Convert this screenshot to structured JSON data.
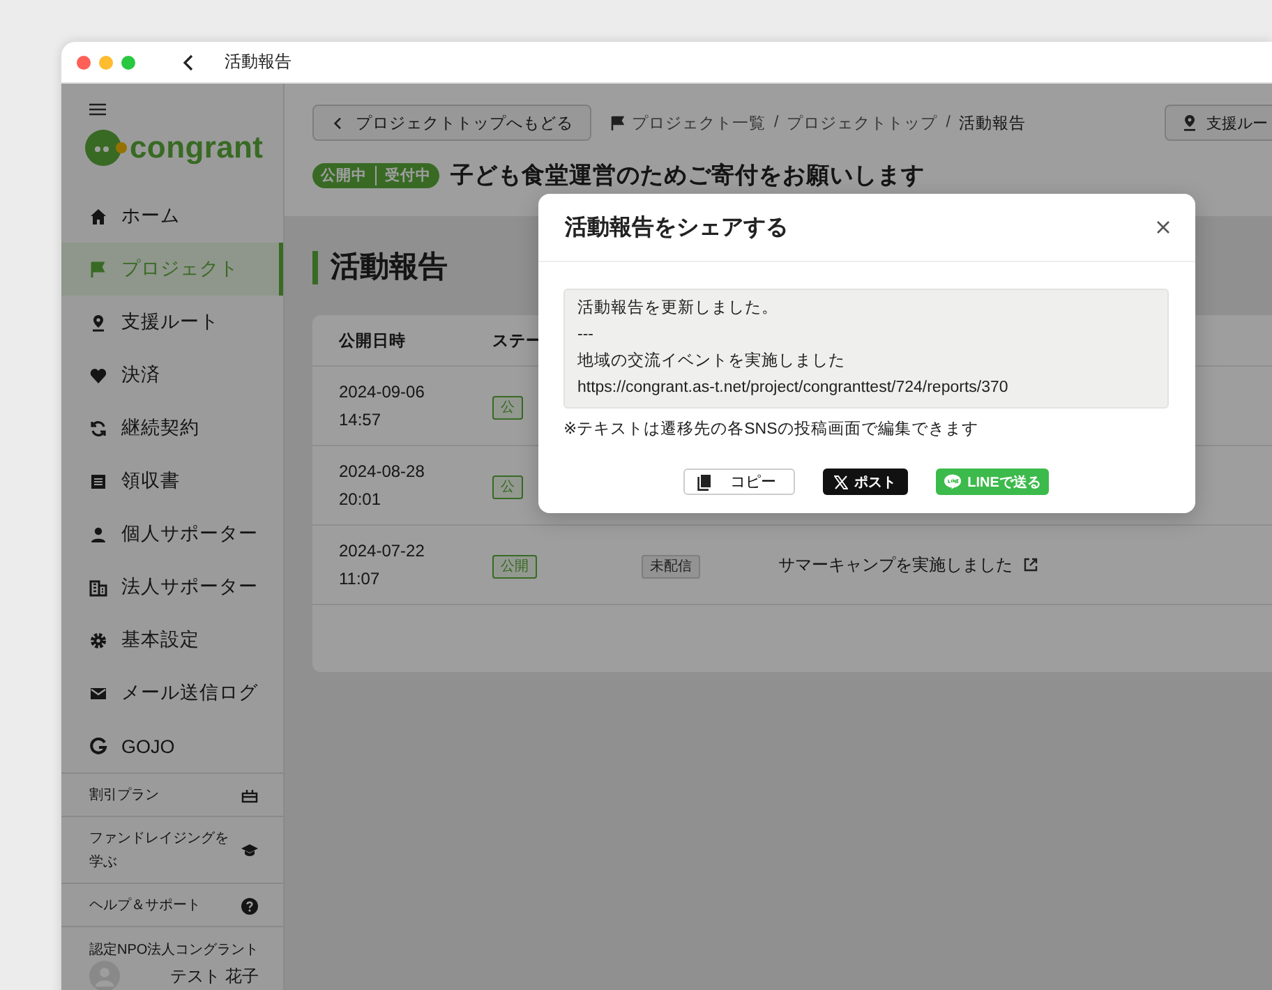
{
  "window": {
    "title": "活動報告"
  },
  "sidebar": {
    "logo_text": "congrant",
    "items": [
      {
        "label": "ホーム",
        "selected": false
      },
      {
        "label": "プロジェクト",
        "selected": true
      },
      {
        "label": "支援ルート",
        "selected": false
      },
      {
        "label": "決済",
        "selected": false
      },
      {
        "label": "継続契約",
        "selected": false
      },
      {
        "label": "領収書",
        "selected": false
      },
      {
        "label": "個人サポーター",
        "selected": false
      },
      {
        "label": "法人サポーター",
        "selected": false
      },
      {
        "label": "基本設定",
        "selected": false
      },
      {
        "label": "メール送信ログ",
        "selected": false
      },
      {
        "label": "GOJO",
        "selected": false
      }
    ],
    "footer_links": [
      {
        "label": "割引プラン"
      },
      {
        "label": "ファンドレイジングを学ぶ"
      },
      {
        "label": "ヘルプ＆サポート"
      }
    ],
    "organization": "認定NPO法人コングラント",
    "user_name": "テスト 花子"
  },
  "header": {
    "back_button": "プロジェクトトップへもどる",
    "breadcrumbs": [
      "プロジェクト一覧",
      "プロジェクトトップ",
      "活動報告"
    ],
    "breadcrumb_separators": [
      "/",
      "/"
    ],
    "right_button": "支援ルー",
    "status_badges": [
      "公開中",
      "受付中"
    ],
    "project_title": "子ども食堂運営のためご寄付をお願いします"
  },
  "page_heading": "活動報告",
  "table": {
    "columns": [
      "公開日時",
      "ステー"
    ],
    "rows": [
      {
        "date": "2024-09-06",
        "time": "14:57",
        "status": "公"
      },
      {
        "date": "2024-08-28",
        "time": "20:01",
        "status": "公"
      },
      {
        "date": "2024-07-22",
        "time": "11:07",
        "status": "公開",
        "delivery": "未配信",
        "title": "サマーキャンプを実施しました"
      }
    ]
  },
  "modal": {
    "title": "活動報告をシェアする",
    "share_text": "活動報告を更新しました。\n---\n地域の交流イベントを実施しました\nhttps://congrant.as-t.net/project/congranttest/724/reports/370",
    "note": "※テキストは遷移先の各SNSの投稿画面で編集できます",
    "buttons": [
      {
        "kind": "copy",
        "label": "コピー"
      },
      {
        "kind": "x",
        "label": "ポスト"
      },
      {
        "kind": "line",
        "label": "LINEで送る"
      }
    ]
  }
}
